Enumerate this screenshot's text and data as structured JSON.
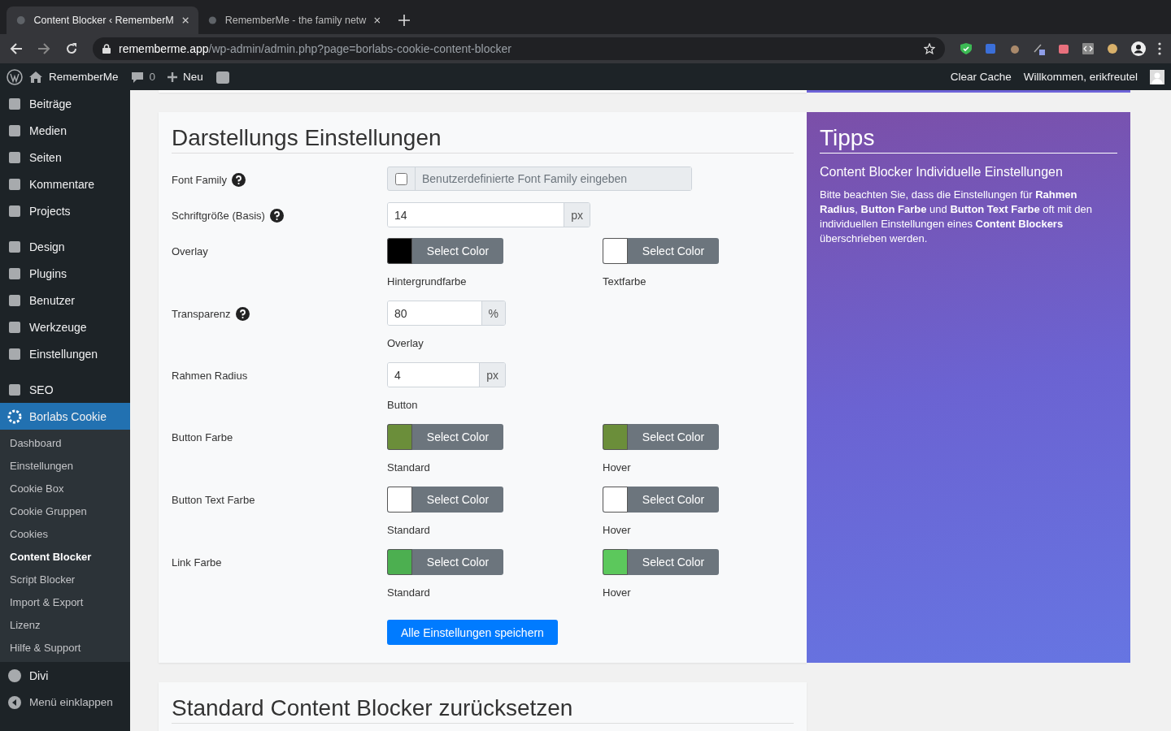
{
  "browser": {
    "tabs": [
      {
        "title": "Content Blocker ‹ RememberM",
        "selected": true
      },
      {
        "title": "RememberMe - the family netw",
        "selected": false
      }
    ],
    "url_host": "rememberme.app",
    "url_path": "/wp-admin/admin.php?page=borlabs-cookie-content-blocker"
  },
  "admin_bar": {
    "site": "RememberMe",
    "comments": "0",
    "new": "Neu",
    "clear_cache": "Clear Cache",
    "greeting": "Willkommen, erikfreutel"
  },
  "sidebar": {
    "groups": [
      {
        "items": [
          {
            "label": "Beiträge",
            "selected": false
          },
          {
            "label": "Medien",
            "selected": false
          },
          {
            "label": "Seiten",
            "selected": false
          },
          {
            "label": "Kommentare",
            "selected": false
          },
          {
            "label": "Projects",
            "selected": false
          }
        ]
      },
      {
        "items": [
          {
            "label": "Design",
            "selected": false
          },
          {
            "label": "Plugins",
            "selected": false
          },
          {
            "label": "Benutzer",
            "selected": false
          },
          {
            "label": "Werkzeuge",
            "selected": false
          },
          {
            "label": "Einstellungen",
            "selected": false
          }
        ]
      },
      {
        "items": [
          {
            "label": "SEO",
            "selected": false
          },
          {
            "label": "Borlabs Cookie",
            "selected": true
          }
        ]
      }
    ],
    "submenu": [
      {
        "label": "Dashboard",
        "selected": false
      },
      {
        "label": "Einstellungen",
        "selected": false
      },
      {
        "label": "Cookie Box",
        "selected": false
      },
      {
        "label": "Cookie Gruppen",
        "selected": false
      },
      {
        "label": "Cookies",
        "selected": false
      },
      {
        "label": "Content Blocker",
        "selected": true
      },
      {
        "label": "Script Blocker",
        "selected": false
      },
      {
        "label": "Import & Export",
        "selected": false
      },
      {
        "label": "Lizenz",
        "selected": false
      },
      {
        "label": "Hilfe & Support",
        "selected": false
      }
    ],
    "bottom": [
      {
        "label": "Divi"
      },
      {
        "label": "Menü einklappen"
      }
    ]
  },
  "panel": {
    "title": "Darstellungs Einstellungen",
    "rows": [
      {
        "kind": "checkbox-input",
        "label": "Font Family",
        "help": true,
        "checked": false,
        "placeholder": "Benutzerdefinierte Font Family eingeben"
      },
      {
        "kind": "input-addon",
        "label": "Schriftgröße (Basis)",
        "help": true,
        "value": "14",
        "addon": "px",
        "wide": true
      },
      {
        "kind": "colors",
        "label": "Overlay",
        "help": false,
        "pickers": [
          {
            "color": "#000000",
            "button": "Select Color",
            "caption": "Hintergrundfarbe"
          },
          {
            "color": "#ffffff",
            "button": "Select Color",
            "caption": "Textfarbe"
          }
        ]
      },
      {
        "kind": "input-addon",
        "label": "Transparenz",
        "help": true,
        "value": "80",
        "addon": "%",
        "wide": false,
        "caption": "Overlay"
      },
      {
        "kind": "input-addon",
        "label": "Rahmen Radius",
        "help": false,
        "value": "4",
        "addon": "px",
        "wide": false,
        "caption": "Button"
      },
      {
        "kind": "colors",
        "label": "Button Farbe",
        "help": false,
        "pickers": [
          {
            "color": "#6b8e3a",
            "button": "Select Color",
            "caption": "Standard"
          },
          {
            "color": "#6b8e3a",
            "button": "Select Color",
            "caption": "Hover"
          }
        ]
      },
      {
        "kind": "colors",
        "label": "Button Text Farbe",
        "help": false,
        "pickers": [
          {
            "color": "#ffffff",
            "button": "Select Color",
            "caption": "Standard"
          },
          {
            "color": "#ffffff",
            "button": "Select Color",
            "caption": "Hover"
          }
        ]
      },
      {
        "kind": "colors",
        "label": "Link Farbe",
        "help": false,
        "pickers": [
          {
            "color": "#4caf50",
            "button": "Select Color",
            "caption": "Standard"
          },
          {
            "color": "#5cc85c",
            "button": "Select Color",
            "caption": "Hover"
          }
        ]
      }
    ],
    "save": "Alle Einstellungen speichern"
  },
  "tips": {
    "title": "Tipps",
    "subtitle": "Content Blocker Individuelle Einstellungen",
    "text": "Bitte beachten Sie, dass die Einstellungen für **Rahmen Radius**, **Button Farbe** und **Button Text Farbe** oft mit den individuellen Einstellungen eines **Content Blockers** überschrieben werden."
  },
  "next_panel": {
    "title": "Standard Content Blocker zurücksetzen"
  }
}
